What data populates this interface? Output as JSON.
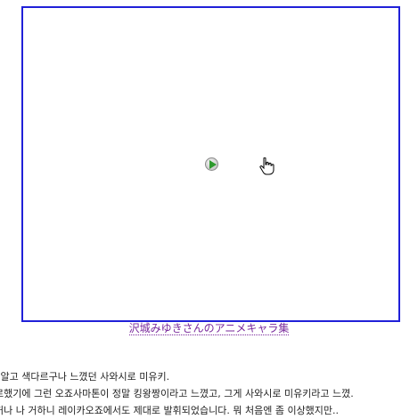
{
  "video": {
    "border_color": "#2020d8",
    "play_icon": "play-icon",
    "cursor_icon": "hand-cursor-icon"
  },
  "caption": {
    "link_text": "沢城みゆきさんのアニメキャラ集",
    "color": "#7a2a9c"
  },
  "article": {
    "lines": [
      "l 알고 색다르구나 느꼈던 사와시로 미유키.",
      "로했기에 그런 오죠사마톤이 정말 킹왕짱이라고 느꼈고, 그게 사와시로 미유키라고 느꼈.",
      "허나 나 거하니 레이카오죠에서도 제대로 발휘되었습니다. 뭐 처음엔 좀 이상했지만.."
    ]
  }
}
